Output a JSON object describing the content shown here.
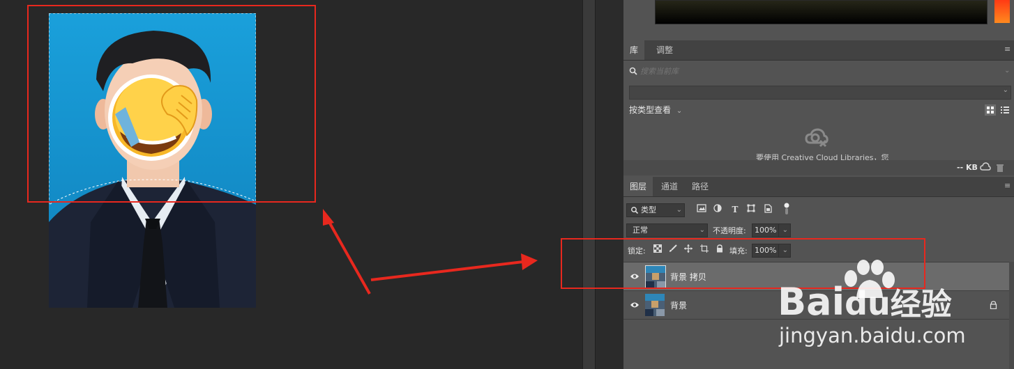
{
  "library_panel": {
    "tabs": [
      "库",
      "调整"
    ],
    "search_placeholder": "搜索当前库",
    "view_by_type_label": "按类型查看",
    "cc_message": "要使用 Creative Cloud Libraries，您",
    "footer_size": "-- KB"
  },
  "layers_panel": {
    "tabs": [
      "图层",
      "通道",
      "路径"
    ],
    "filter_kind": "类型",
    "blend_mode": "正常",
    "opacity_label": "不透明度:",
    "opacity_value": "100%",
    "lock_label": "锁定:",
    "fill_label": "填充:",
    "fill_value": "100%",
    "layers": [
      {
        "name": "背景 拷贝",
        "selected": true,
        "locked": false
      },
      {
        "name": "背景",
        "selected": false,
        "locked": true
      }
    ]
  },
  "icons": {
    "search": "search-icon",
    "panel_menu": "panel-menu-icon",
    "grid_view": "grid-view-icon",
    "list_view": "list-view-icon",
    "cloud_offline": "cloud-offline-icon",
    "trash": "trash-icon",
    "eye": "eye-icon",
    "lock": "lock-icon"
  },
  "watermark": {
    "brand_left": "Bai",
    "brand_mid": "du",
    "brand_suffix": "经验",
    "url": "jingyan.baidu.com"
  },
  "colors": {
    "annotation_red": "#e8281e",
    "panel_bg": "#535353",
    "canvas_bg": "#282828",
    "photo_bg": "#1a9bd4",
    "selected_layer": "#6b6b6b"
  }
}
